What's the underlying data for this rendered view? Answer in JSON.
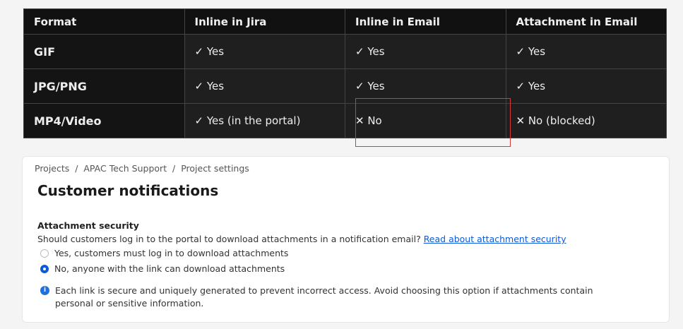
{
  "table": {
    "headers": [
      "Format",
      "Inline in Jira",
      "Inline in Email",
      "Attachment in Email"
    ],
    "rows": [
      [
        "GIF",
        "✓ Yes",
        "✓ Yes",
        "✓ Yes"
      ],
      [
        "JPG/PNG",
        "✓ Yes",
        "✓ Yes",
        "✓ Yes"
      ],
      [
        "MP4/Video",
        "✓ Yes (in the portal)",
        "✕ No",
        "✕ No (blocked)"
      ]
    ]
  },
  "card": {
    "breadcrumb": "Projects  /  APAC Tech Support  /  Project settings",
    "title": "Customer notifications",
    "section_label": "Attachment security",
    "question": "Should customers log in to the portal to download attachments in a notification email? ",
    "link": "Read about attachment security",
    "options": [
      {
        "label": "Yes, customers must log in to download attachments",
        "selected": false
      },
      {
        "label": "No, anyone with the link can download attachments",
        "selected": true
      }
    ],
    "info": "Each link is secure and uniquely generated to prevent incorrect access. Avoid choosing this option if attachments contain personal or sensitive information.",
    "info_icon": "i"
  },
  "colors": {
    "accent": "#0c5adb",
    "highlight": "#d9363e"
  }
}
